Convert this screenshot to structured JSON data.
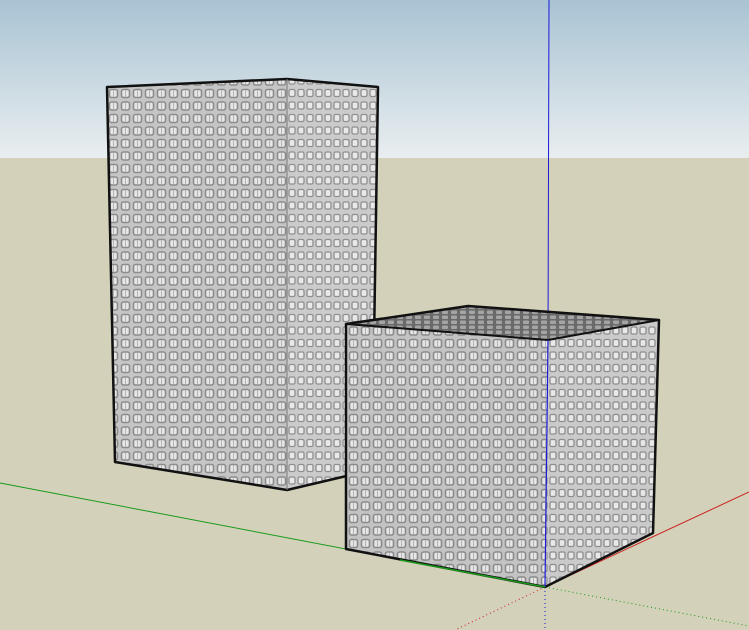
{
  "viewport": {
    "sky_top_color": "#a9c3d3",
    "sky_bottom_color": "#e9eef0",
    "ground_color": "#d3d1b9",
    "axis_colors": {
      "red": "#cc2222",
      "green": "#1a9a1a",
      "blue": "#1a1ad8"
    },
    "models": [
      {
        "name": "tall-box",
        "icon": "glass-box-array"
      },
      {
        "name": "cube",
        "icon": "glass-box-array"
      }
    ]
  }
}
